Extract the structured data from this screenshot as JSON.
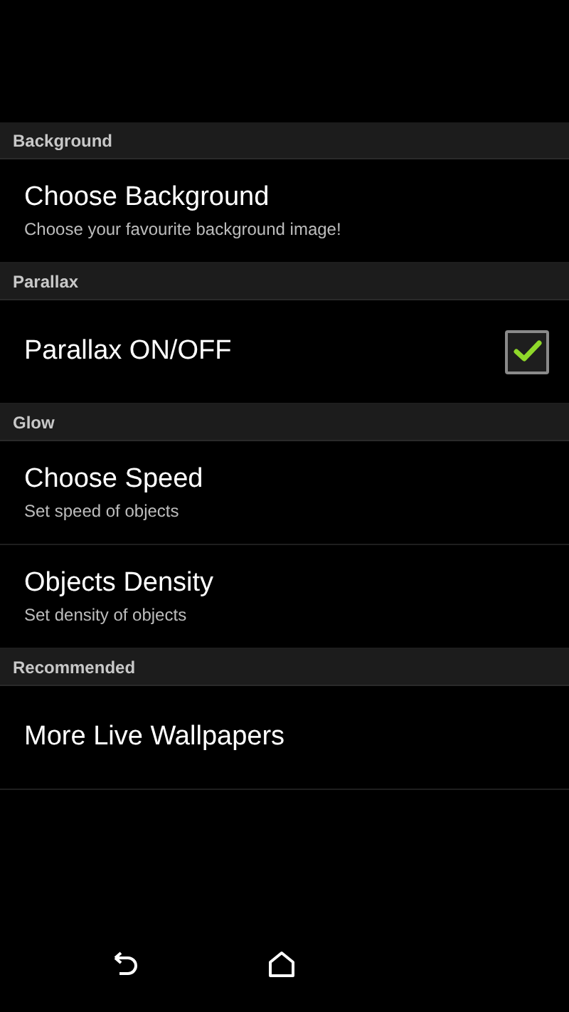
{
  "sections": [
    {
      "header": "Background",
      "items": [
        {
          "kind": "text",
          "title": "Choose Background",
          "summary": "Choose your favourite background image!"
        }
      ]
    },
    {
      "header": "Parallax",
      "items": [
        {
          "kind": "checkbox",
          "title": "Parallax ON/OFF",
          "checked": true
        }
      ]
    },
    {
      "header": "Glow",
      "items": [
        {
          "kind": "text",
          "title": "Choose Speed",
          "summary": "Set speed of objects"
        },
        {
          "kind": "text",
          "title": "Objects Density",
          "summary": "Set density of objects"
        }
      ]
    },
    {
      "header": "Recommended",
      "items": [
        {
          "kind": "text",
          "title": "More Live Wallpapers"
        }
      ]
    }
  ]
}
